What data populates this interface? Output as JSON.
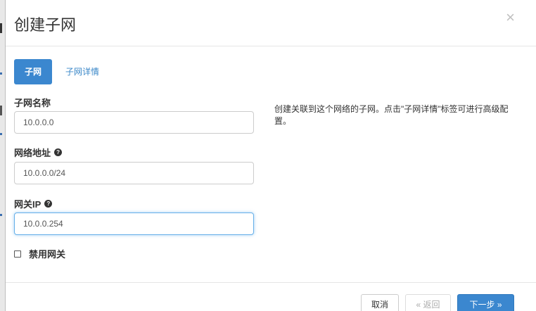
{
  "dialog": {
    "title": "创建子网",
    "close_symbol": "×"
  },
  "tabs": [
    {
      "label": "子网",
      "active": true
    },
    {
      "label": "子网详情",
      "active": false
    }
  ],
  "fields": {
    "subnet_name": {
      "label": "子网名称",
      "value": "10.0.0.0"
    },
    "network_address": {
      "label": "网络地址",
      "value": "10.0.0.0/24"
    },
    "gateway_ip": {
      "label": "网关IP",
      "value": "10.0.0.254"
    }
  },
  "help_icon_glyph": "?",
  "disable_gateway": {
    "label": "禁用网关",
    "checked": false
  },
  "help_text": "创建关联到这个网络的子网。点击\"子网详情\"标签可进行高级配置。",
  "footer": {
    "cancel_label": "取消",
    "back_label": "« 返回",
    "next_label": "下一步 »"
  },
  "colors": {
    "primary": "#3b87cf",
    "focus": "#66afe9"
  }
}
